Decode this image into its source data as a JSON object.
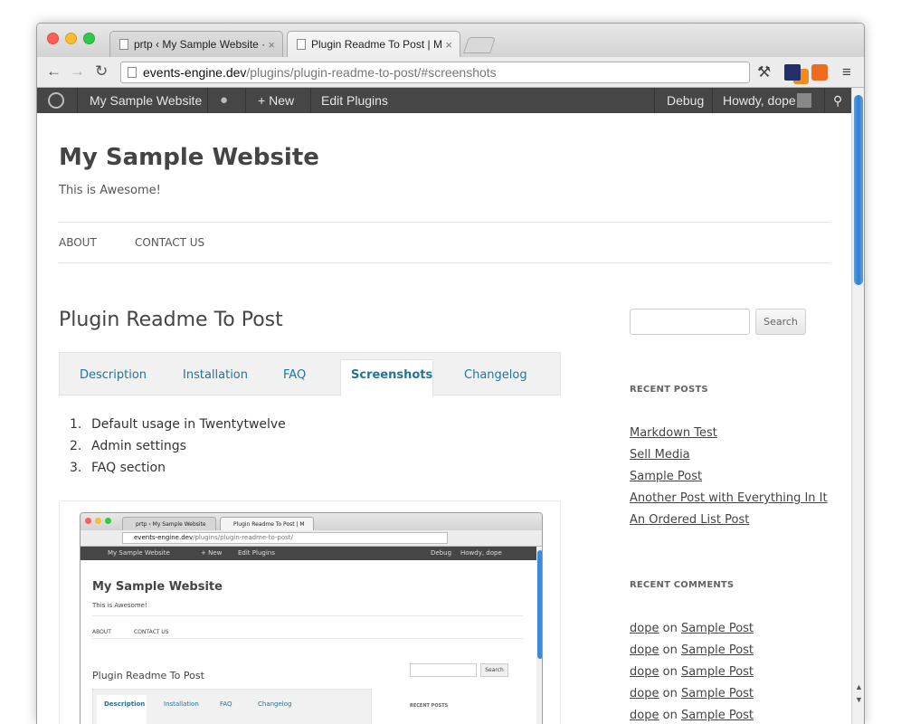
{
  "browser": {
    "tabs": [
      {
        "title": "prtp ‹ My Sample Website ·"
      },
      {
        "title": "Plugin Readme To Post | M"
      }
    ],
    "close_glyph": "×",
    "url_host": "events-engine.dev",
    "url_path": "/plugins/plugin-readme-to-post/#screenshots"
  },
  "admin_bar": {
    "site_name": "My Sample Website",
    "new_label": "New",
    "new_glyph": "+",
    "edit_plugins": "Edit Plugins",
    "debug": "Debug",
    "howdy": "Howdy, dope"
  },
  "site": {
    "title": "My Sample Website",
    "tagline": "This is Awesome!",
    "menu": [
      "ABOUT",
      "CONTACT US"
    ]
  },
  "post": {
    "title": "Plugin Readme To Post",
    "tabs": [
      "Description",
      "Installation",
      "FAQ",
      "Screenshots",
      "Changelog"
    ],
    "active_tab": "Screenshots",
    "list": [
      {
        "num": "1.",
        "text": "Default usage in Twentytwelve"
      },
      {
        "num": "2.",
        "text": "Admin settings"
      },
      {
        "num": "3.",
        "text": "FAQ section"
      }
    ]
  },
  "sidebar": {
    "search_button": "Search",
    "recent_posts_title": "RECENT POSTS",
    "recent_posts": [
      "Markdown Test",
      "Sell Media",
      "Sample Post",
      "Another Post with Everything In It",
      "An Ordered List Post"
    ],
    "recent_comments_title": "RECENT COMMENTS",
    "recent_comments": [
      {
        "author": "dope",
        "on": "on",
        "post": "Sample Post"
      },
      {
        "author": "dope",
        "on": "on",
        "post": "Sample Post"
      },
      {
        "author": "dope",
        "on": "on",
        "post": "Sample Post"
      },
      {
        "author": "dope",
        "on": "on",
        "post": "Sample Post"
      },
      {
        "author": "dope",
        "on": "on",
        "post": "Sample Post"
      }
    ]
  },
  "screenshot": {
    "tab1": "prtp ‹ My Sample Website",
    "tab2": "Plugin Readme To Post | M",
    "url_host": "events-engine.dev",
    "url_path": "/plugins/plugin-readme-to-post/",
    "bar_site": "My Sample Website",
    "bar_new": "+ New",
    "bar_edit": "Edit Plugins",
    "bar_debug": "Debug",
    "bar_howdy": "Howdy, dope",
    "site_title": "My Sample Website",
    "tagline": "This is Awesome!",
    "menu_about": "ABOUT",
    "menu_contact": "CONTACT US",
    "post_title": "Plugin Readme To Post",
    "tabs": [
      "Description",
      "Installation",
      "FAQ",
      "Changelog"
    ],
    "search": "Search",
    "recent_posts": "RECENT POSTS"
  },
  "colors": {
    "admin_bar": "#464646",
    "link_blue": "#21759b",
    "scroll_thumb": "#2f7fcf"
  }
}
